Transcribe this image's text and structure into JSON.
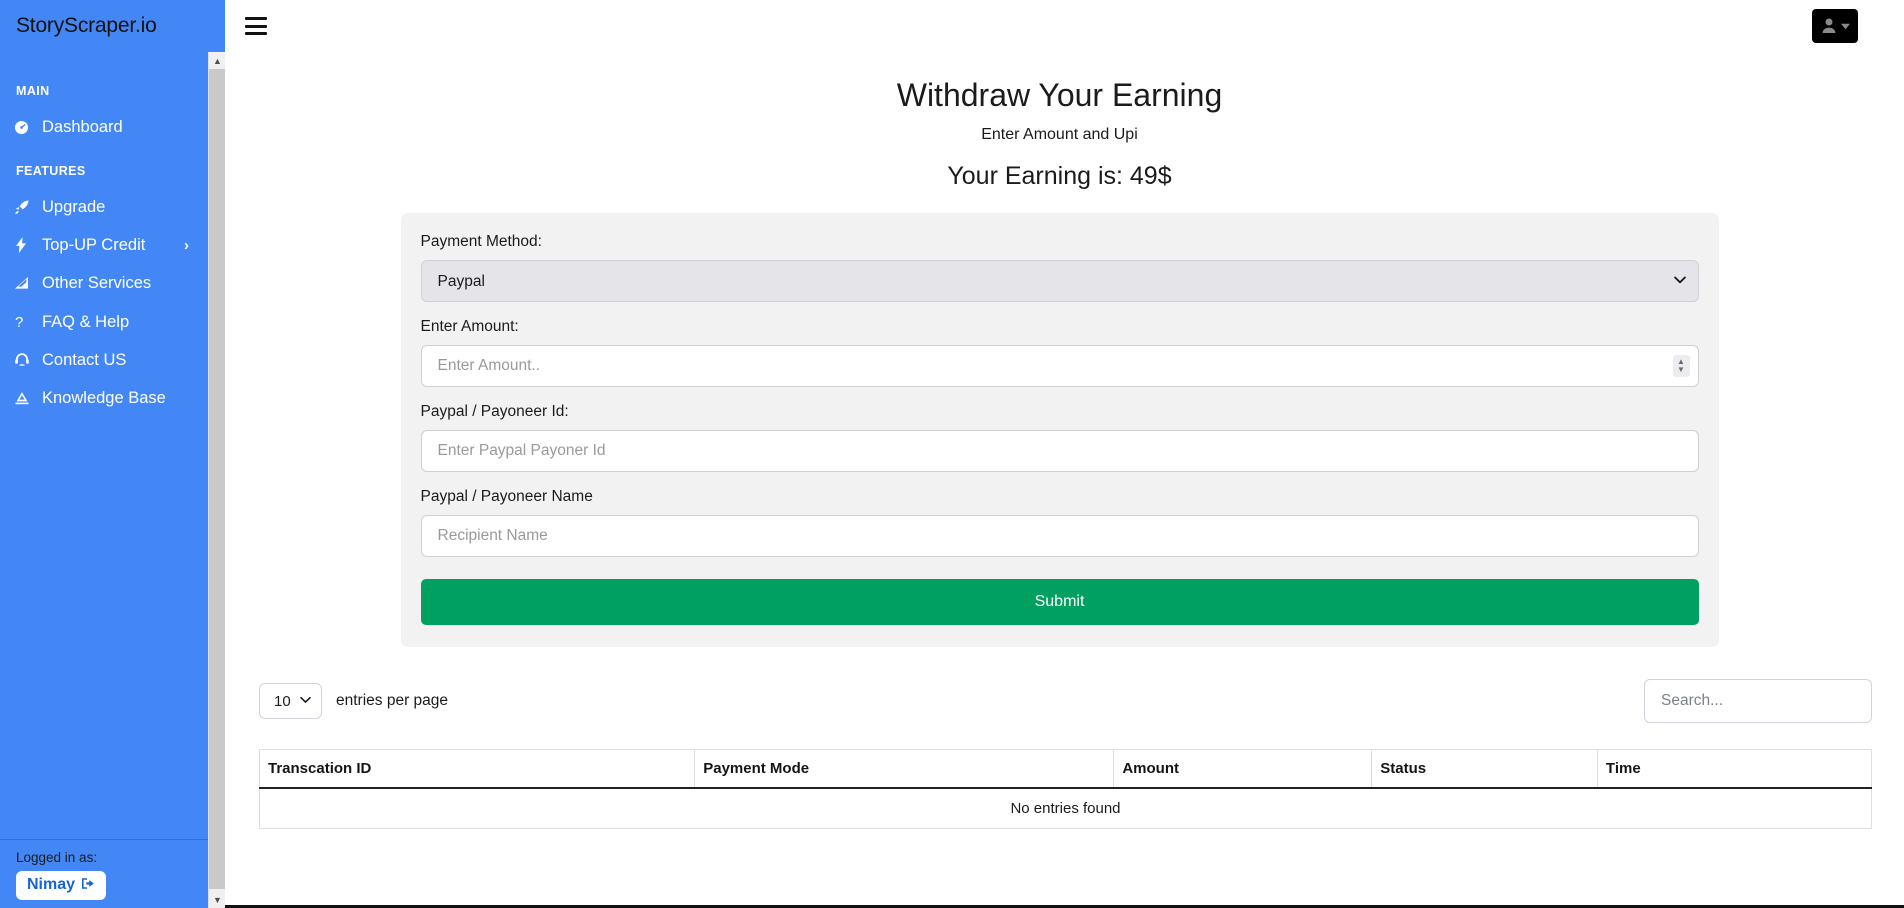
{
  "brand": {
    "name": "StoryScraper.io"
  },
  "sidebar": {
    "sections": [
      {
        "heading": "MAIN",
        "items": [
          {
            "label": "Dashboard",
            "icon": "tachometer-icon",
            "caret": ""
          }
        ]
      },
      {
        "heading": "FEATURES",
        "items": [
          {
            "label": "Upgrade",
            "icon": "rocket-icon",
            "caret": ""
          },
          {
            "label": "Top-UP Credit",
            "icon": "bolt-icon",
            "caret": "›"
          },
          {
            "label": "Other Services",
            "icon": "signal-icon",
            "caret": ""
          },
          {
            "label": "FAQ & Help",
            "icon": "question-icon",
            "caret": ""
          },
          {
            "label": "Contact US",
            "icon": "headset-icon",
            "caret": ""
          },
          {
            "label": "Knowledge Base",
            "icon": "book-icon",
            "caret": ""
          }
        ]
      }
    ],
    "footer": {
      "logged_in_label": "Logged in as:",
      "user_name": "Nimay",
      "logout_icon": "sign-out-icon"
    }
  },
  "topbar": {
    "menu_icon": "hamburger-icon",
    "user_icon": "user-icon",
    "user_caret_icon": "caret-down-icon"
  },
  "page": {
    "title": "Withdraw Your Earning",
    "subtitle": "Enter Amount and Upi",
    "earning_line": "Your Earning is: 49$",
    "earning_amount": "49$"
  },
  "form": {
    "payment_method": {
      "label": "Payment Method:",
      "selected": "Paypal",
      "options": [
        "Paypal"
      ]
    },
    "amount": {
      "label": "Enter Amount:",
      "value": "",
      "placeholder": "Enter Amount.."
    },
    "payoneer_id": {
      "label": "Paypal / Payoneer Id:",
      "value": "",
      "placeholder": "Enter Paypal Payoner Id"
    },
    "payoneer_name": {
      "label": "Paypal / Payoneer Name",
      "value": "",
      "placeholder": "Recipient Name"
    },
    "submit_label": "Submit"
  },
  "table": {
    "entries_selected": "10",
    "entries_options": [
      "10"
    ],
    "entries_text": "entries per page",
    "search_placeholder": "Search...",
    "search_value": "",
    "columns": [
      "Transcation ID",
      "Payment Mode",
      "Amount",
      "Status",
      "Time"
    ],
    "rows": [],
    "empty_text": "No entries found"
  },
  "colors": {
    "sidebar_blue": "#4287f5",
    "submit_green": "#00a160",
    "card_grey": "#f2f2f2",
    "select_grey": "#e4e4e9"
  }
}
